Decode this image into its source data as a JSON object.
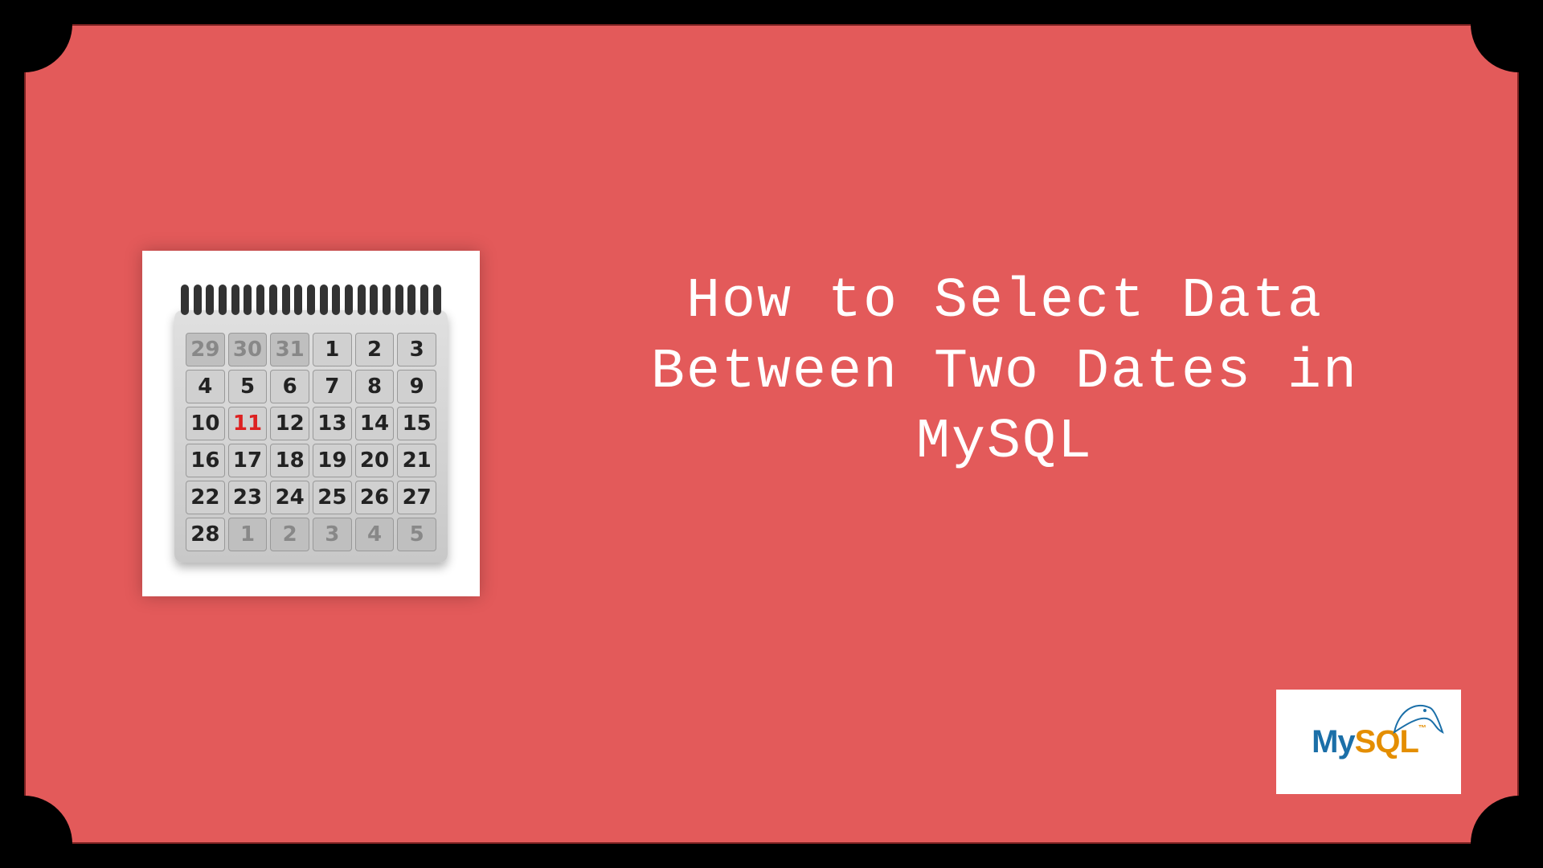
{
  "title": "How to Select Data Between Two Dates in MySQL",
  "badge": {
    "my": "My",
    "sql": "SQL",
    "tm": "™"
  },
  "calendar": {
    "cells": [
      {
        "n": "29",
        "dim": true
      },
      {
        "n": "30",
        "dim": true
      },
      {
        "n": "31",
        "dim": true
      },
      {
        "n": "1"
      },
      {
        "n": "2"
      },
      {
        "n": "3"
      },
      {
        "n": "4"
      },
      {
        "n": "5"
      },
      {
        "n": "6"
      },
      {
        "n": "7"
      },
      {
        "n": "8"
      },
      {
        "n": "9"
      },
      {
        "n": "10"
      },
      {
        "n": "11",
        "today": true
      },
      {
        "n": "12"
      },
      {
        "n": "13"
      },
      {
        "n": "14"
      },
      {
        "n": "15"
      },
      {
        "n": "16"
      },
      {
        "n": "17"
      },
      {
        "n": "18"
      },
      {
        "n": "19"
      },
      {
        "n": "20"
      },
      {
        "n": "21"
      },
      {
        "n": "22"
      },
      {
        "n": "23"
      },
      {
        "n": "24"
      },
      {
        "n": "25"
      },
      {
        "n": "26"
      },
      {
        "n": "27"
      },
      {
        "n": "28"
      },
      {
        "n": "1",
        "dim": true
      },
      {
        "n": "2",
        "dim": true
      },
      {
        "n": "3",
        "dim": true
      },
      {
        "n": "4",
        "dim": true
      },
      {
        "n": "5",
        "dim": true
      }
    ]
  }
}
